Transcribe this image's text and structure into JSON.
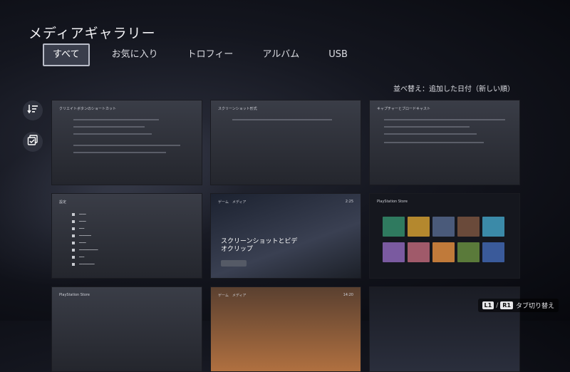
{
  "title": "メディアギャラリー",
  "tabs": [
    {
      "label": "すべて",
      "active": true
    },
    {
      "label": "お気に入り",
      "active": false
    },
    {
      "label": "トロフィー",
      "active": false
    },
    {
      "label": "アルバム",
      "active": false
    },
    {
      "label": "USB",
      "active": false
    }
  ],
  "sort_label": "並べ替え：追加した日付（新しい順）",
  "side_buttons": [
    {
      "icon": "sort-list-icon"
    },
    {
      "icon": "multi-select-icon"
    }
  ],
  "thumbnails": [
    {
      "heading": "クリエイトボタンのショートカット"
    },
    {
      "heading": "スクリーンショット形式"
    },
    {
      "heading": "キャプチャーとブロードキャスト"
    },
    {
      "heading": "設定"
    },
    {
      "heading": "スクリーンショットとビデオクリップ",
      "nav1": "ゲーム",
      "nav2": "メディア",
      "time": "2:25"
    },
    {
      "heading": "PlayStation Store"
    },
    {
      "heading": "PlayStation Store"
    },
    {
      "heading": "",
      "nav1": "ゲーム",
      "nav2": "メディア",
      "time": "14:20"
    },
    {
      "heading": ""
    }
  ],
  "hint": {
    "key1": "L1",
    "key2": "R1",
    "label": "タブ切り替え"
  },
  "colors": {
    "background": "#14161f",
    "active_tab": "#3a3e4c"
  }
}
